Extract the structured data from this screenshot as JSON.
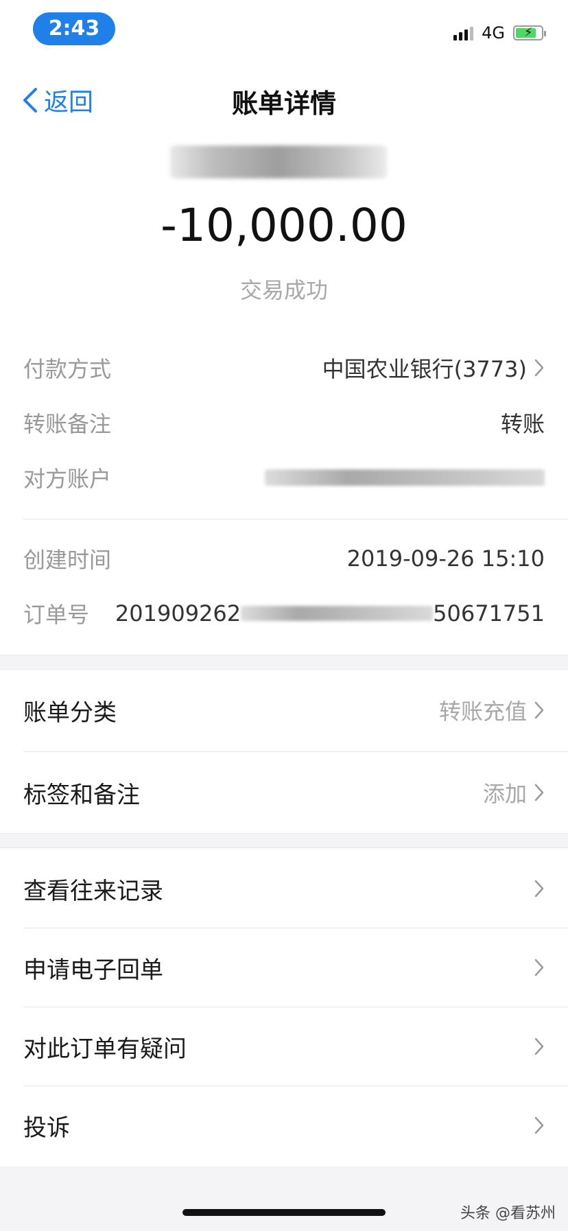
{
  "status_bar": {
    "time": "2:43",
    "network": "4G",
    "icons": [
      "signal-icon",
      "battery-charging-icon"
    ],
    "battery_level": 0.8
  },
  "nav": {
    "back_label": "返回",
    "title": "账单详情"
  },
  "summary": {
    "amount": "-10,000.00",
    "status": "交易成功"
  },
  "details": {
    "payment_method": {
      "label": "付款方式",
      "value": "中国农业银行(3773)"
    },
    "transfer_note": {
      "label": "转账备注",
      "value": "转账"
    },
    "counterparty": {
      "label": "对方账户"
    },
    "created_time": {
      "label": "创建时间",
      "value": "2019-09-26 15:10"
    },
    "order_no": {
      "label": "订单号",
      "prefix": "201909262",
      "suffix": "50671751"
    }
  },
  "classify": {
    "category": {
      "label": "账单分类",
      "value": "转账充值"
    },
    "tags": {
      "label": "标签和备注",
      "value": "添加"
    }
  },
  "actions": [
    {
      "label": "查看往来记录"
    },
    {
      "label": "申请电子回单"
    },
    {
      "label": "对此订单有疑问"
    },
    {
      "label": "投诉"
    }
  ],
  "watermark": "头条 @看苏州",
  "colors": {
    "accent": "#1f80ea",
    "secondary_text": "#999999",
    "background_gap": "#f4f4f6"
  }
}
